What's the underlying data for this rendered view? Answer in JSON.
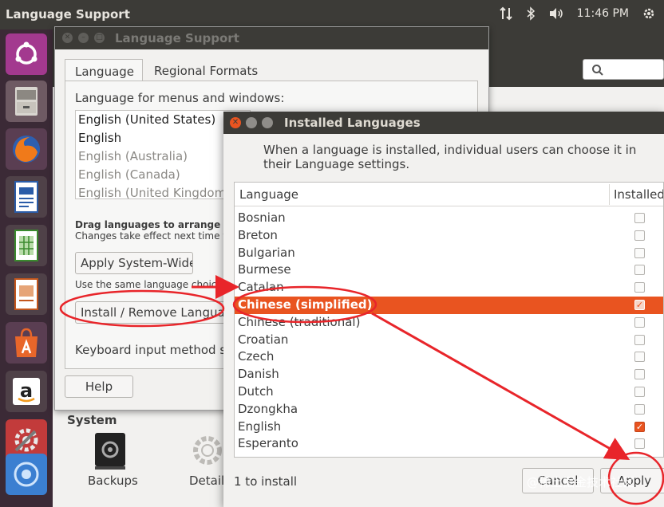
{
  "top_panel": {
    "title": "Language Support",
    "time": "11:46 PM"
  },
  "launcher": {
    "items": [
      "ubuntu-dash",
      "files",
      "firefox",
      "libreoffice-writer",
      "libreoffice-calc",
      "libreoffice-impress",
      "software-center",
      "amazon",
      "system-settings",
      "unknown-app"
    ]
  },
  "background_window": {
    "system_label": "System",
    "items": [
      "Backups",
      "Detail"
    ]
  },
  "language_support": {
    "title": "Language Support",
    "tabs": [
      "Language",
      "Regional Formats"
    ],
    "heading": "Language for menus and windows:",
    "languages": [
      "English (United States)",
      "English",
      "English (Australia)",
      "English (Canada)",
      "English (United Kingdom)"
    ],
    "drag_title": "Drag languages to arrange ther",
    "drag_subtitle": "Changes take effect next time yo",
    "apply_system_wide": "Apply System-Wide",
    "same_choices_text": "Use the same language choices f",
    "install_remove": "Install / Remove Languag",
    "keyboard_text": "Keyboard input method sy",
    "help": "Help"
  },
  "installed_languages": {
    "title": "Installed Languages",
    "description": "When a language is installed, individual users can choose it in their Language settings.",
    "col_language": "Language",
    "col_installed": "Installed",
    "rows": [
      {
        "name": "Bosnian",
        "installed": false,
        "selected": false
      },
      {
        "name": "Breton",
        "installed": false,
        "selected": false
      },
      {
        "name": "Bulgarian",
        "installed": false,
        "selected": false
      },
      {
        "name": "Burmese",
        "installed": false,
        "selected": false
      },
      {
        "name": "Catalan",
        "installed": false,
        "selected": false
      },
      {
        "name": "Chinese (simplified)",
        "installed": true,
        "selected": true
      },
      {
        "name": "Chinese (traditional)",
        "installed": false,
        "selected": false
      },
      {
        "name": "Croatian",
        "installed": false,
        "selected": false
      },
      {
        "name": "Czech",
        "installed": false,
        "selected": false
      },
      {
        "name": "Danish",
        "installed": false,
        "selected": false
      },
      {
        "name": "Dutch",
        "installed": false,
        "selected": false
      },
      {
        "name": "Dzongkha",
        "installed": false,
        "selected": false
      },
      {
        "name": "English",
        "installed": true,
        "selected": false
      },
      {
        "name": "Esperanto",
        "installed": false,
        "selected": false
      }
    ],
    "status": "1 to install",
    "cancel": "Cancel",
    "apply": "Apply"
  },
  "watermark": "@稀土掘金技术社区",
  "colors": {
    "accent": "#e95420",
    "annotation": "#e8252a"
  }
}
